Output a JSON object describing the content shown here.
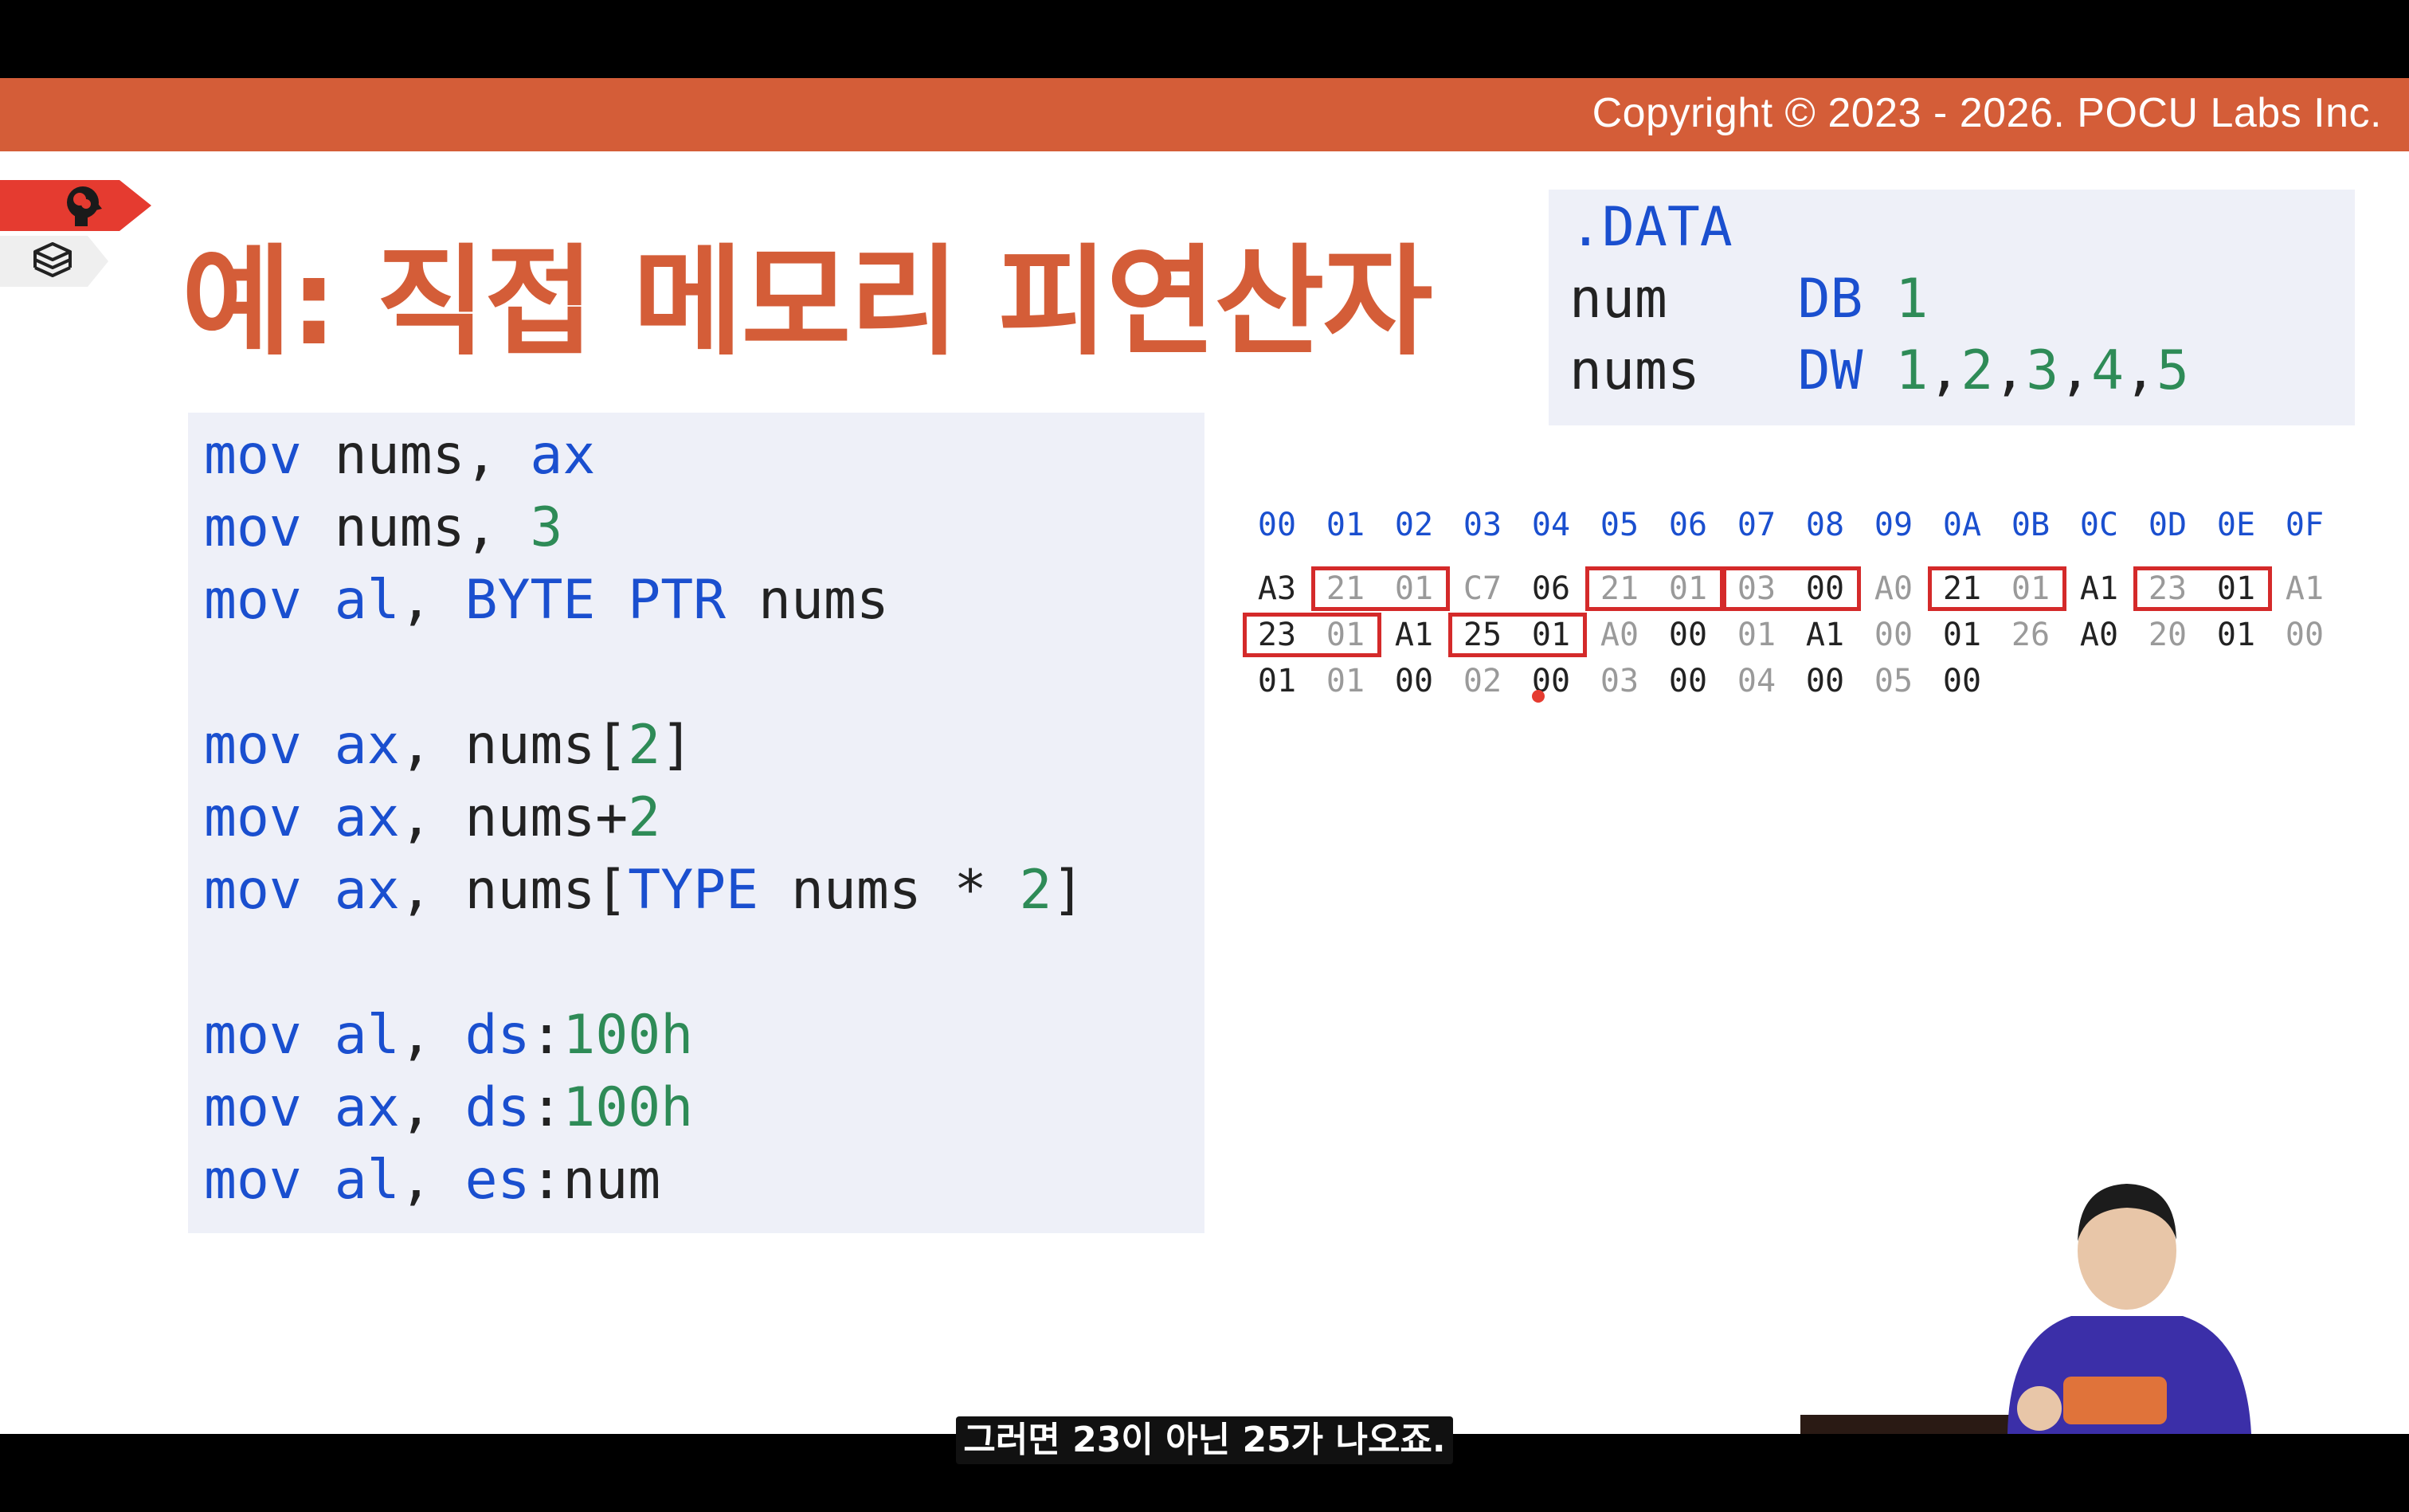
{
  "header": {
    "copyright": "Copyright © 2023 - 2026. POCU Labs Inc."
  },
  "slide": {
    "title": "예: 직접 메모리 피연산자"
  },
  "code": {
    "lines": [
      [
        {
          "t": "mov",
          "c": "kw"
        },
        {
          "t": " nums, "
        },
        {
          "t": "ax",
          "c": "kw"
        }
      ],
      [
        {
          "t": "mov",
          "c": "kw"
        },
        {
          "t": " nums, "
        },
        {
          "t": "3",
          "c": "num"
        }
      ],
      [
        {
          "t": "mov",
          "c": "kw"
        },
        {
          "t": " "
        },
        {
          "t": "al",
          "c": "kw"
        },
        {
          "t": ", "
        },
        {
          "t": "BYTE PTR",
          "c": "kw"
        },
        {
          "t": " nums"
        }
      ],
      [],
      [
        {
          "t": "mov",
          "c": "kw"
        },
        {
          "t": " "
        },
        {
          "t": "ax",
          "c": "kw"
        },
        {
          "t": ", nums["
        },
        {
          "t": "2",
          "c": "num"
        },
        {
          "t": "]"
        }
      ],
      [
        {
          "t": "mov",
          "c": "kw"
        },
        {
          "t": " "
        },
        {
          "t": "ax",
          "c": "kw"
        },
        {
          "t": ", nums+"
        },
        {
          "t": "2",
          "c": "num"
        }
      ],
      [
        {
          "t": "mov",
          "c": "kw"
        },
        {
          "t": " "
        },
        {
          "t": "ax",
          "c": "kw"
        },
        {
          "t": ", nums["
        },
        {
          "t": "TYPE",
          "c": "kw"
        },
        {
          "t": " nums * "
        },
        {
          "t": "2",
          "c": "num"
        },
        {
          "t": "]"
        }
      ],
      [],
      [
        {
          "t": "mov",
          "c": "kw"
        },
        {
          "t": " "
        },
        {
          "t": "al",
          "c": "kw"
        },
        {
          "t": ", "
        },
        {
          "t": "ds",
          "c": "kw"
        },
        {
          "t": ":"
        },
        {
          "t": "100h",
          "c": "num"
        }
      ],
      [
        {
          "t": "mov",
          "c": "kw"
        },
        {
          "t": " "
        },
        {
          "t": "ax",
          "c": "kw"
        },
        {
          "t": ", "
        },
        {
          "t": "ds",
          "c": "kw"
        },
        {
          "t": ":"
        },
        {
          "t": "100h",
          "c": "num"
        }
      ],
      [
        {
          "t": "mov",
          "c": "kw"
        },
        {
          "t": " "
        },
        {
          "t": "al",
          "c": "kw"
        },
        {
          "t": ", "
        },
        {
          "t": "es",
          "c": "kw"
        },
        {
          "t": ":num"
        }
      ]
    ]
  },
  "data_section": {
    "lines": [
      [
        {
          "t": ".DATA",
          "c": "kw"
        }
      ],
      [
        {
          "t": "num    "
        },
        {
          "t": "DB",
          "c": "kw"
        },
        {
          "t": " "
        },
        {
          "t": "1",
          "c": "num"
        }
      ],
      [
        {
          "t": "nums   "
        },
        {
          "t": "DW",
          "c": "kw"
        },
        {
          "t": " "
        },
        {
          "t": "1",
          "c": "num"
        },
        {
          "t": ","
        },
        {
          "t": "2",
          "c": "num"
        },
        {
          "t": ","
        },
        {
          "t": "3",
          "c": "num"
        },
        {
          "t": ","
        },
        {
          "t": "4",
          "c": "num"
        },
        {
          "t": ","
        },
        {
          "t": "5",
          "c": "num"
        }
      ]
    ]
  },
  "hex_dump": {
    "header": [
      "00",
      "01",
      "02",
      "03",
      "04",
      "05",
      "06",
      "07",
      "08",
      "09",
      "0A",
      "0B",
      "0C",
      "0D",
      "0E",
      "0F"
    ],
    "rows": [
      [
        {
          "v": "A3",
          "d": true
        },
        {
          "v": "21"
        },
        {
          "v": "01"
        },
        {
          "v": "C7"
        },
        {
          "v": "06",
          "d": true
        },
        {
          "v": "21"
        },
        {
          "v": "01"
        },
        {
          "v": "03"
        },
        {
          "v": "00",
          "d": true
        },
        {
          "v": "A0"
        },
        {
          "v": "21",
          "d": true
        },
        {
          "v": "01"
        },
        {
          "v": "A1",
          "d": true
        },
        {
          "v": "23"
        },
        {
          "v": "01",
          "d": true
        },
        {
          "v": "A1"
        }
      ],
      [
        {
          "v": "23",
          "d": true
        },
        {
          "v": "01"
        },
        {
          "v": "A1",
          "d": true
        },
        {
          "v": "25",
          "d": true
        },
        {
          "v": "01",
          "d": true
        },
        {
          "v": "A0"
        },
        {
          "v": "00",
          "d": true
        },
        {
          "v": "01"
        },
        {
          "v": "A1",
          "d": true
        },
        {
          "v": "00"
        },
        {
          "v": "01",
          "d": true
        },
        {
          "v": "26"
        },
        {
          "v": "A0",
          "d": true
        },
        {
          "v": "20"
        },
        {
          "v": "01",
          "d": true
        },
        {
          "v": "00"
        }
      ],
      [
        {
          "v": "01",
          "d": true
        },
        {
          "v": "01"
        },
        {
          "v": "00",
          "d": true
        },
        {
          "v": "02"
        },
        {
          "v": "00",
          "d": true
        },
        {
          "v": "03"
        },
        {
          "v": "00",
          "d": true
        },
        {
          "v": "04"
        },
        {
          "v": "00",
          "d": true
        },
        {
          "v": "05"
        },
        {
          "v": "00",
          "d": true
        }
      ]
    ],
    "highlights": [
      {
        "row": 0,
        "from": 1,
        "to": 2
      },
      {
        "row": 0,
        "from": 5,
        "to": 6
      },
      {
        "row": 0,
        "from": 7,
        "to": 8
      },
      {
        "row": 0,
        "from": 10,
        "to": 11
      },
      {
        "row": 0,
        "from": 13,
        "to": 14
      },
      {
        "row": 1,
        "from": 0,
        "to": 1
      },
      {
        "row": 1,
        "from": 3,
        "to": 4
      }
    ]
  },
  "subtitle": "그러면 23이 아닌 25가 나오죠.",
  "colors": {
    "accent": "#d45d38",
    "keyword": "#1a4fcf",
    "number": "#2e8b57",
    "highlight": "#d42a2a"
  },
  "icons": [
    "head-brain-icon",
    "books-icon"
  ]
}
